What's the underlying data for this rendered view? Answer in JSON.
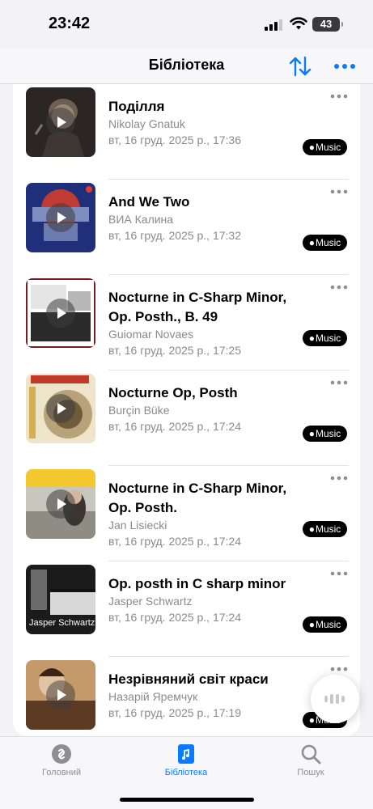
{
  "status": {
    "time": "23:42",
    "battery": "43"
  },
  "nav": {
    "title": "Бібліотека"
  },
  "badge_label": "Music",
  "songs": [
    {
      "title": "Поділля",
      "artist": "Nikolay Gnatuk",
      "date": "вт, 16 груд. 2025 р., 17:36"
    },
    {
      "title": "And We Two",
      "artist": "ВИА Калина",
      "date": "вт, 16 груд. 2025 р., 17:32"
    },
    {
      "title": "Nocturne in C-Sharp Minor, Op. Posth., B. 49",
      "artist": "Guiomar Novaes",
      "date": "вт, 16 груд. 2025 р., 17:25"
    },
    {
      "title": "Nocturne Op, Posth",
      "artist": "Burçin Büke",
      "date": "вт, 16 груд. 2025 р., 17:24"
    },
    {
      "title": "Nocturne in C-Sharp Minor, Op. Posth.",
      "artist": "Jan Lisiecki",
      "date": "вт, 16 груд. 2025 р., 17:24"
    },
    {
      "title": "Op. posth in C sharp minor",
      "artist": "Jasper Schwartz",
      "date": "вт, 16 груд. 2025 р., 17:24",
      "art_text": "Jasper Schwartz"
    },
    {
      "title": "Незрівняний світ краси",
      "artist": "Назарій Яремчук",
      "date": "вт, 16 груд. 2025 р., 17:19"
    }
  ],
  "tabs": [
    {
      "label": "Головний",
      "icon": "shazam-icon"
    },
    {
      "label": "Бібліотека",
      "icon": "library-icon",
      "active": true
    },
    {
      "label": "Пошук",
      "icon": "search-icon"
    }
  ],
  "colors": {
    "accent": "#0a7aff",
    "secondary_text": "#8a8a8e"
  }
}
